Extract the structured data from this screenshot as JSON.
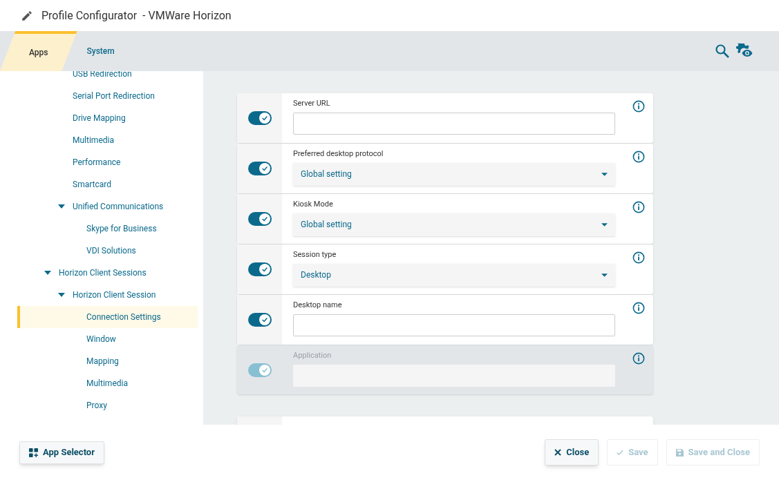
{
  "window": {
    "title": "Profile Configurator  - VMWare Horizon"
  },
  "tabs": [
    {
      "label": "Apps",
      "selected": true
    },
    {
      "label": "System",
      "selected": false
    }
  ],
  "tree": [
    {
      "children": [
        {
          "label": "USB Redirection",
          "selected": false
        },
        {
          "label": "Serial Port Redirection",
          "selected": false
        },
        {
          "label": "Drive Mapping",
          "selected": false
        },
        {
          "label": "Multimedia",
          "selected": false
        },
        {
          "label": "Performance",
          "selected": false
        },
        {
          "label": "Smartcard",
          "selected": false
        },
        {
          "label": "Unified Communications",
          "selected": false,
          "expanded": true,
          "children": [
            {
              "label": "Skype for Business",
              "selected": false
            },
            {
              "label": "VDI Solutions",
              "selected": false
            }
          ]
        }
      ]
    },
    {
      "label": "Horizon Client Sessions",
      "selected": false,
      "expanded": true,
      "children": [
        {
          "label": "Horizon Client Session",
          "selected": false,
          "expanded": true,
          "children": [
            {
              "label": "Connection Settings",
              "selected": true
            },
            {
              "label": "Window",
              "selected": false
            },
            {
              "label": "Mapping",
              "selected": false
            },
            {
              "label": "Multimedia",
              "selected": false
            },
            {
              "label": "Proxy",
              "selected": false
            }
          ]
        }
      ]
    }
  ],
  "settings": [
    {
      "kind": "text",
      "label": "Server URL",
      "on": true,
      "disabled": false
    },
    {
      "kind": "select",
      "label": "Preferred desktop protocol",
      "value": "Global setting",
      "on": true,
      "disabled": false
    },
    {
      "kind": "select",
      "label": "Kiosk Mode",
      "value": "Global setting",
      "on": true,
      "disabled": false
    },
    {
      "kind": "select",
      "label": "Session type",
      "value": "Desktop",
      "on": true,
      "disabled": false
    },
    {
      "kind": "text",
      "label": "Desktop name",
      "on": true,
      "disabled": false
    },
    {
      "kind": "text",
      "label": "Application",
      "on": true,
      "disabled": true
    }
  ],
  "footer": {
    "left": [
      {
        "label": "App Selector",
        "disabled": false
      }
    ],
    "right": [
      {
        "kind": "close",
        "label": "Close",
        "disabled": false
      },
      {
        "kind": "save",
        "label": "Save",
        "disabled": true
      },
      {
        "kind": "save-close",
        "label": "Save and Close",
        "disabled": true
      }
    ]
  }
}
